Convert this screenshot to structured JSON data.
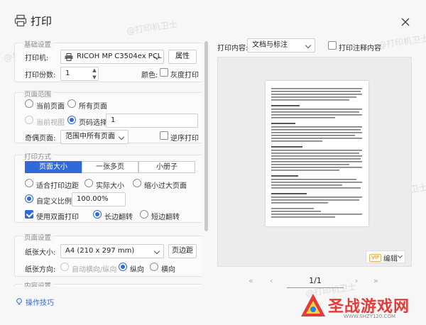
{
  "window": {
    "title": "打印"
  },
  "watermark": "@打印机卫士",
  "basic": {
    "title": "基础设置",
    "printer_label": "打印机:",
    "printer_value": "RICOH MP C3504ex PCL 6",
    "properties_button": "属性",
    "copies_label": "打印份数:",
    "copies_value": "1",
    "color_label": "颜色:",
    "grayscale_label": "灰度打印"
  },
  "range": {
    "title": "页面范围",
    "current_page": "当前页面",
    "all_pages": "所有页面",
    "current_view": "当前视图",
    "page_select": "页码选择:",
    "page_select_value": "1",
    "odd_even_label": "奇偶页面:",
    "odd_even_value": "范围中所有页面",
    "reverse_label": "逆序打印"
  },
  "mode": {
    "title": "打印方式",
    "tabs": [
      "页面大小",
      "一张多页",
      "小册子"
    ],
    "fit_margin": "适合打印边距",
    "actual_size": "实际大小",
    "shrink_large": "缩小过大页面",
    "custom_scale": "自定义比例",
    "custom_scale_value": "100.00%",
    "duplex": "使用双面打印",
    "long_edge": "长边翻转",
    "short_edge": "短边翻转"
  },
  "page_setup": {
    "title": "页面设置",
    "paper_size_label": "纸张大小:",
    "paper_size_value": "A4 (210 x 297 mm)",
    "margins_button": "页边距",
    "orientation_label": "纸张方向:",
    "auto": "自动横向/纵向",
    "portrait": "纵向",
    "landscape": "横向"
  },
  "content_title": "内容设置",
  "tips": "操作技巧",
  "right": {
    "content_label": "打印内容:",
    "content_value": "文档与标注",
    "annotations_label": "打印注释内容",
    "vip": "VIP",
    "edit": "编辑",
    "page_indicator": "1/1"
  },
  "logo": {
    "text": "圣战游戏网",
    "url": "WWW.SHZY120.COM"
  },
  "colors": {
    "accent": "#2f6ad6",
    "logo_red": "#e53a3a"
  }
}
